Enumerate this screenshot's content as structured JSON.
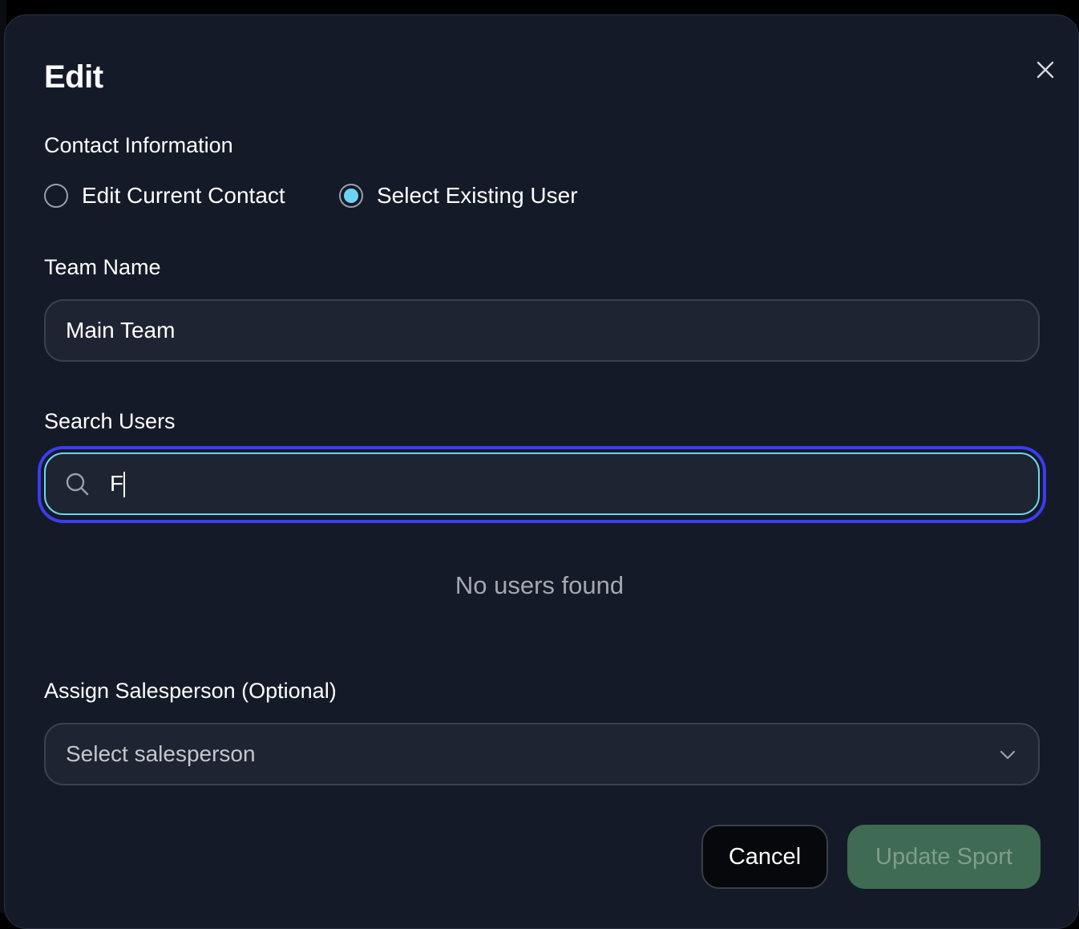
{
  "dialog": {
    "title": "Edit",
    "close_icon": "close-icon"
  },
  "contact": {
    "label": "Contact Information",
    "options": [
      {
        "label": "Edit Current Contact",
        "selected": false
      },
      {
        "label": "Select Existing User",
        "selected": true
      }
    ]
  },
  "team": {
    "label": "Team Name",
    "value": "Main Team"
  },
  "search": {
    "label": "Search Users",
    "value": "F",
    "icon": "search-icon",
    "empty_message": "No users found"
  },
  "salesperson": {
    "label": "Assign Salesperson (Optional)",
    "placeholder": "Select salesperson",
    "icon": "chevron-down-icon"
  },
  "actions": {
    "cancel_label": "Cancel",
    "submit_label": "Update Sport"
  },
  "colors": {
    "background": "#141a28",
    "radio_selected": "#6ed3f2",
    "focus_ring": "#3c3cf0",
    "focus_border": "#6fd6ee",
    "submit_button": "#3e6b52"
  }
}
